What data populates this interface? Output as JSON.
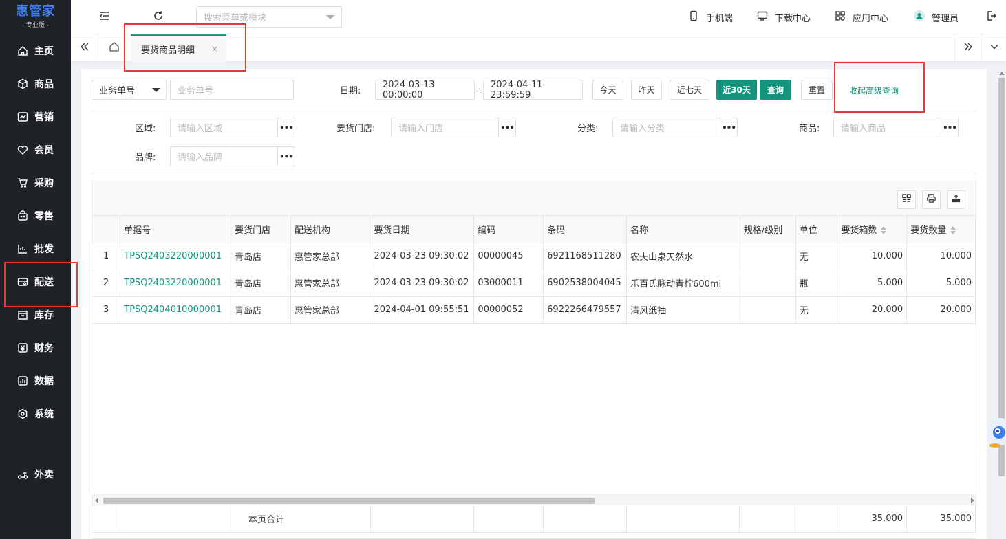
{
  "brand": {
    "name": "惠管家",
    "edition": "- 专业版 -"
  },
  "sidebar": {
    "items": [
      {
        "label": "主页",
        "icon": "home-icon"
      },
      {
        "label": "商品",
        "icon": "box-icon"
      },
      {
        "label": "营销",
        "icon": "chart-icon"
      },
      {
        "label": "会员",
        "icon": "heart-icon"
      },
      {
        "label": "采购",
        "icon": "cart-icon"
      },
      {
        "label": "零售",
        "icon": "bag-icon"
      },
      {
        "label": "批发",
        "icon": "wholesale-icon"
      },
      {
        "label": "配送",
        "icon": "delivery-icon"
      },
      {
        "label": "库存",
        "icon": "warehouse-icon"
      },
      {
        "label": "财务",
        "icon": "yen-icon"
      },
      {
        "label": "数据",
        "icon": "data-icon"
      },
      {
        "label": "系统",
        "icon": "gear-icon"
      },
      {
        "label": "外卖",
        "icon": "scooter-icon"
      }
    ]
  },
  "topbar": {
    "search_placeholder": "搜索菜单或模块",
    "mobile": "手机端",
    "download": "下载中心",
    "apps": "应用中心",
    "user": "管理员"
  },
  "tabs": {
    "active": "要货商品明细",
    "close": "×"
  },
  "filters": {
    "type_select": "业务单号",
    "order_placeholder": "业务单号",
    "date_label": "日期:",
    "date_start": "2024-03-13 00:00:00",
    "date_sep": "-",
    "date_end": "2024-04-11 23:59:59",
    "btn_today": "今天",
    "btn_yesterday": "昨天",
    "btn_7days": "近七天",
    "btn_30days": "近30天",
    "btn_query": "查询",
    "btn_reset": "重置",
    "advanced": "收起高级查询",
    "region_label": "区域:",
    "region_placeholder": "请输入区域",
    "store_label": "要货门店:",
    "store_placeholder": "请输入门店",
    "category_label": "分类:",
    "category_placeholder": "请输入分类",
    "product_label": "商品:",
    "product_placeholder": "请输入商品",
    "brand_label": "品牌:",
    "brand_placeholder": "请输入品牌",
    "more": "•••"
  },
  "table": {
    "columns": [
      "单据号",
      "要货门店",
      "配送机构",
      "要货日期",
      "编码",
      "条码",
      "名称",
      "规格/级别",
      "单位",
      "要货箱数",
      "要货数量"
    ],
    "rows": [
      {
        "idx": "1",
        "order": "TPSQ2403220000001",
        "store": "青岛店",
        "org": "惠管家总部",
        "date": "2024-03-23 09:30:02",
        "code": "00000045",
        "barcode": "6921168511280",
        "name": "农夫山泉天然水",
        "spec": "",
        "unit": "无",
        "boxes": "10.000",
        "qty": "10.000"
      },
      {
        "idx": "2",
        "order": "TPSQ2403220000001",
        "store": "青岛店",
        "org": "惠管家总部",
        "date": "2024-03-23 09:30:02",
        "code": "03000011",
        "barcode": "6902538004045",
        "name": "乐百氏脉动青柠600ml",
        "spec": "",
        "unit": "瓶",
        "boxes": "5.000",
        "qty": "5.000"
      },
      {
        "idx": "3",
        "order": "TPSQ2404010000001",
        "store": "青岛店",
        "org": "惠管家总部",
        "date": "2024-04-01 09:55:51",
        "code": "00000052",
        "barcode": "6922266479557",
        "name": "清风纸抽",
        "spec": "",
        "unit": "无",
        "boxes": "20.000",
        "qty": "20.000"
      }
    ],
    "footer": {
      "label": "本页合计",
      "boxes": "35.000",
      "qty": "35.000"
    }
  },
  "colors": {
    "accent": "#15947d",
    "sidebar": "#1f2328",
    "highlight": "#e53935"
  }
}
